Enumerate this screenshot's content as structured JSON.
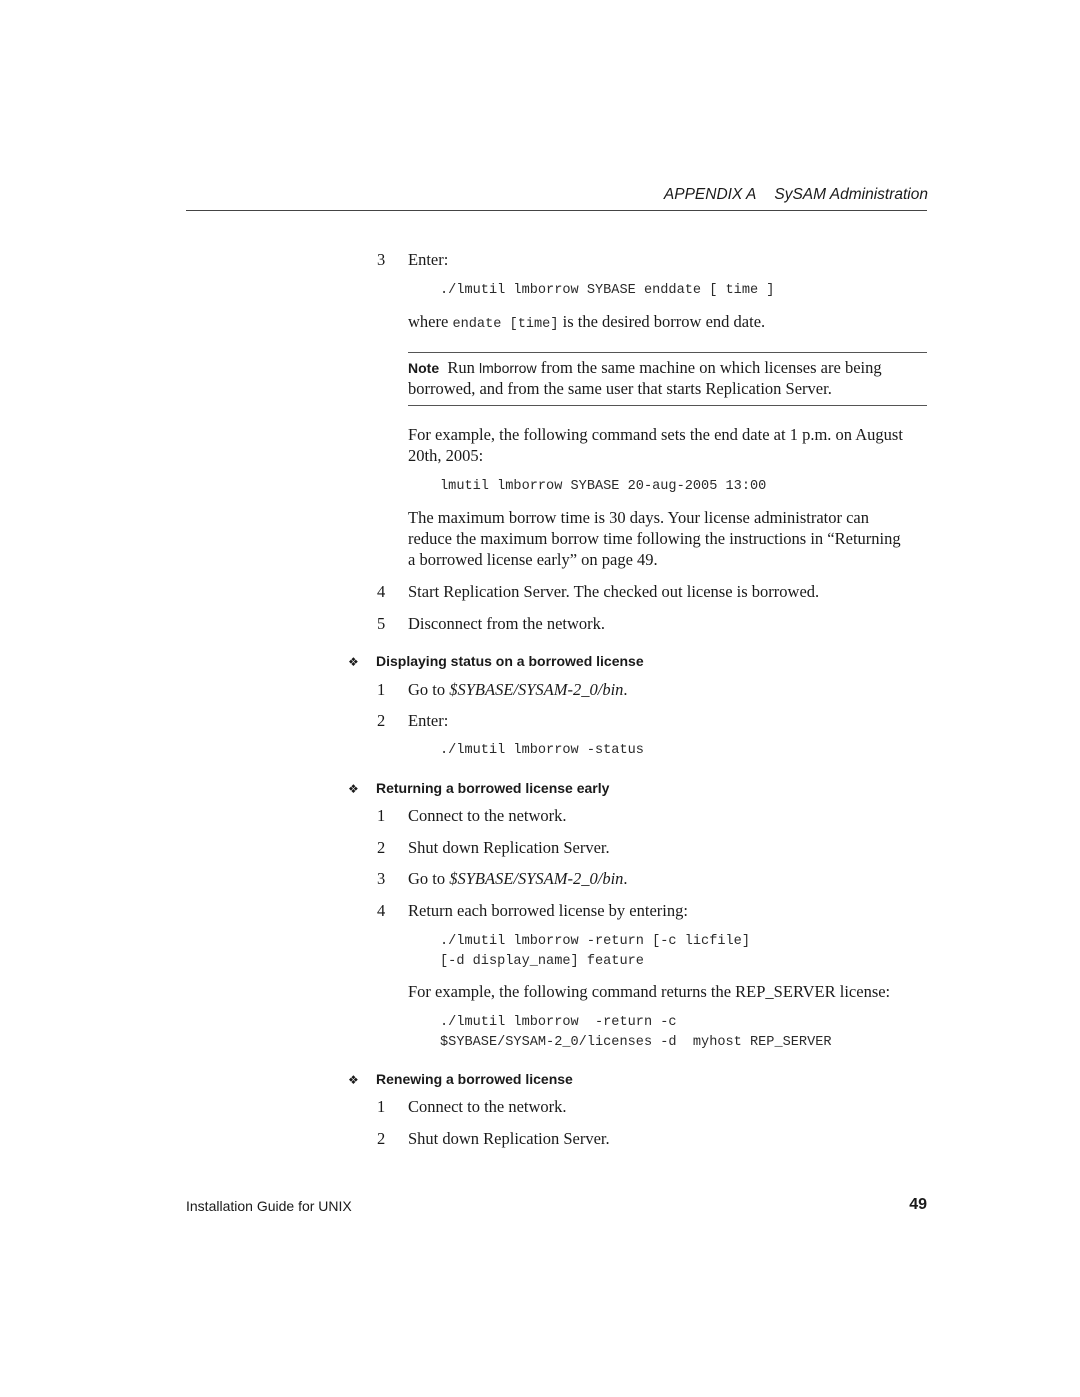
{
  "header": {
    "appendix": "APPENDIX A",
    "title": "SySAM Administration"
  },
  "step3": {
    "num": "3",
    "label": "Enter:"
  },
  "code1": "./lmutil lmborrow SYBASE enddate [ time ]",
  "where": {
    "pre": "where ",
    "code": "endate [time]",
    "post": " is the desired borrow end date."
  },
  "note": {
    "label": "Note",
    "pre": "Run ",
    "cmd": "lmborrow",
    "line1_post": " from the same machine on which licenses are being",
    "line2": "borrowed, and from the same user that starts Replication Server."
  },
  "example1": {
    "line1": "For example, the following command sets the end date at 1 p.m. on August",
    "line2": "20th, 2005:"
  },
  "code2": "lmutil lmborrow SYBASE 20-aug-2005 13:00",
  "maxborrow": {
    "line1": "The maximum borrow time is 30 days. Your license administrator can",
    "line2": "reduce the maximum borrow time following the instructions in “Returning",
    "line3": "a borrowed license early” on page 49."
  },
  "step4": {
    "num": "4",
    "text": "Start Replication Server. The checked out license is borrowed."
  },
  "step5": {
    "num": "5",
    "text": "Disconnect from the network."
  },
  "sections": [
    {
      "title": "Displaying status on a borrowed license",
      "steps": [
        {
          "num": "1",
          "pre": "Go to ",
          "path": "$SYBASE/SYSAM-2_0/bin",
          "post": "."
        },
        {
          "num": "2",
          "text": "Enter:"
        }
      ],
      "code": "./lmutil lmborrow -status"
    },
    {
      "title": "Returning a borrowed license early",
      "steps": [
        {
          "num": "1",
          "text": "Connect to the network."
        },
        {
          "num": "2",
          "text": "Shut down Replication Server."
        },
        {
          "num": "3",
          "pre": "Go to ",
          "path": "$SYBASE/SYSAM-2_0/bin",
          "post": "."
        },
        {
          "num": "4",
          "text": "Return each borrowed license by entering:"
        }
      ],
      "code": [
        "./lmutil lmborrow -return [-c licfile]",
        "[-d display_name] feature"
      ],
      "example": "For example, the following command returns the REP_SERVER license:",
      "example_code": [
        "./lmutil lmborrow  -return -c",
        "$SYBASE/SYSAM-2_0/licenses -d  myhost REP_SERVER"
      ]
    },
    {
      "title": "Renewing a borrowed license",
      "steps": [
        {
          "num": "1",
          "text": "Connect to the network."
        },
        {
          "num": "2",
          "text": "Shut down Replication Server."
        }
      ]
    }
  ],
  "bullet_glyph": "❖",
  "footer": {
    "left": "Installation Guide for UNIX",
    "page": "49"
  }
}
